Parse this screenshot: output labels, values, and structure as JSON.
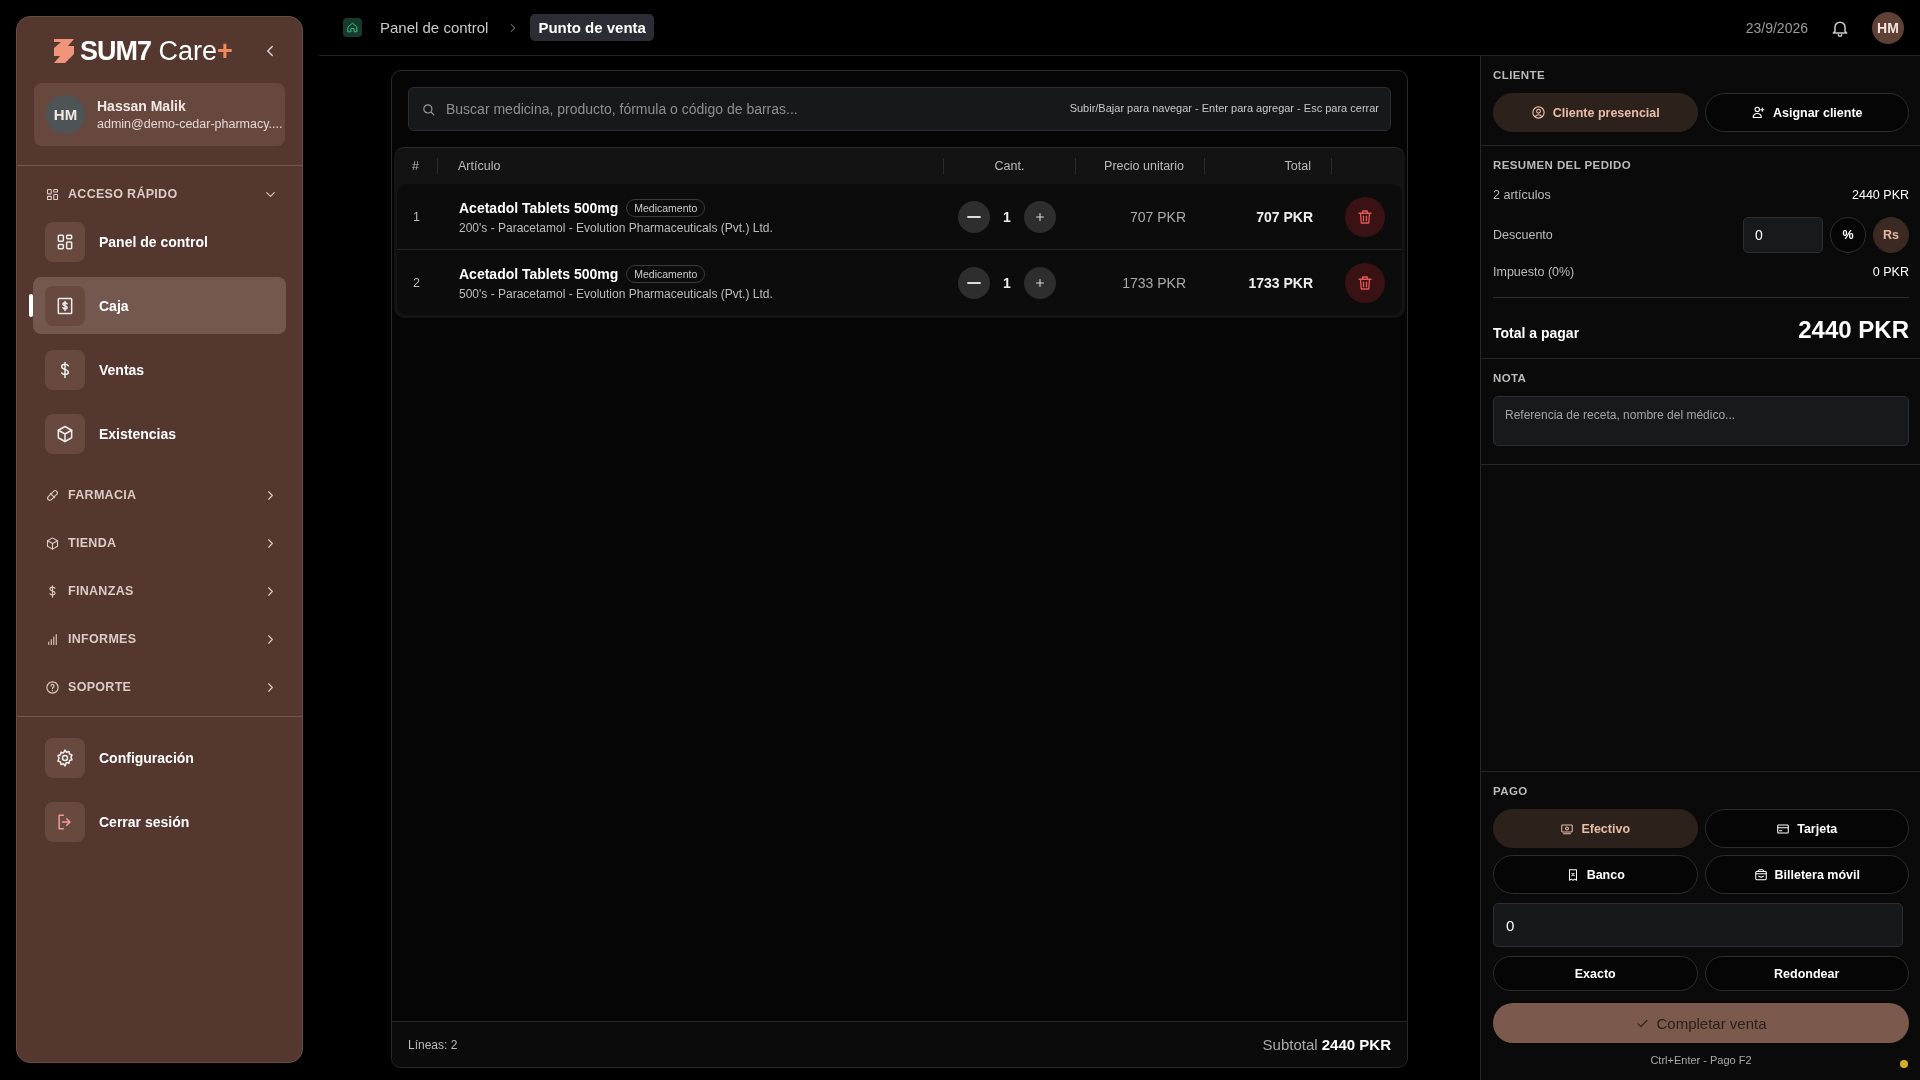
{
  "sidebar": {
    "logo": {
      "brand": "SUM7",
      "product": "Care",
      "accent": "+"
    },
    "user": {
      "initials": "HM",
      "name": "Hassan Malik",
      "email": "admin@demo-cedar-pharmacy...."
    },
    "quick_access": {
      "label": "ACCESO RÁPIDO",
      "expanded": true,
      "items": [
        {
          "label": "Panel de control",
          "selected": false
        },
        {
          "label": "Caja",
          "selected": true
        },
        {
          "label": "Ventas",
          "selected": false
        },
        {
          "label": "Existencias",
          "selected": false
        }
      ]
    },
    "groups": [
      {
        "label": "FARMACIA"
      },
      {
        "label": "TIENDA"
      },
      {
        "label": "FINANZAS"
      },
      {
        "label": "INFORMES"
      },
      {
        "label": "SOPORTE"
      }
    ],
    "footer_items": [
      {
        "label": "Configuración"
      },
      {
        "label": "Cerrar sesión"
      }
    ]
  },
  "topbar": {
    "breadcrumbs": [
      {
        "label": "Panel de control",
        "selected": false
      },
      {
        "label": "Punto de venta",
        "selected": true
      }
    ],
    "date": "23/9/2026",
    "avatar": "HM"
  },
  "cart": {
    "search": {
      "placeholder": "Buscar medicina, producto, fórmula o código de barras...",
      "hint": "Subir/Bajar para navegar - Enter para agregar - Esc para cerrar"
    },
    "columns": [
      "#",
      "Artículo",
      "Cant.",
      "Precio unitario",
      "Total"
    ],
    "rows": [
      {
        "index": "1",
        "name": "Acetadol Tablets 500mg",
        "tag": "Medicamento",
        "detail": "200's - Paracetamol - Evolution Pharmaceuticals (Pvt.) Ltd.",
        "qty": "1",
        "unit_price": "707 PKR",
        "total": "707 PKR"
      },
      {
        "index": "2",
        "name": "Acetadol Tablets 500mg",
        "tag": "Medicamento",
        "detail": "500's - Paracetamol - Evolution Pharmaceuticals (Pvt.) Ltd.",
        "qty": "1",
        "unit_price": "1733 PKR",
        "total": "1733 PKR"
      }
    ],
    "lines": "Líneas: 2",
    "subtotal_label": "Subtotal",
    "subtotal": "2440 PKR"
  },
  "panel": {
    "client": {
      "title": "CLIENTE",
      "options": [
        {
          "label": "Cliente presencial",
          "selected": true
        },
        {
          "label": "Asignar cliente",
          "selected": false
        }
      ]
    },
    "summary": {
      "title": "RESUMEN DEL PEDIDO",
      "items_label": "2 artículos",
      "items_value": "2440 PKR",
      "discount_label": "Descuento",
      "discount_value": "0",
      "discount_modes": [
        {
          "label": "%",
          "selected": false
        },
        {
          "label": "Rs",
          "selected": true
        }
      ],
      "tax_label": "Impuesto (0%)",
      "tax_value": "0 PKR",
      "total_label": "Total a pagar",
      "total_value": "2440 PKR"
    },
    "note": {
      "title": "NOTA",
      "placeholder": "Referencia de receta, nombre del médico..."
    },
    "payment": {
      "title": "PAGO",
      "methods": [
        {
          "label": "Efectivo",
          "selected": true
        },
        {
          "label": "Tarjeta",
          "selected": false
        },
        {
          "label": "Banco",
          "selected": false
        },
        {
          "label": "Billetera móvil",
          "selected": false
        }
      ],
      "amount": "0",
      "quick_buttons": [
        "Exacto",
        "Redondear"
      ],
      "complete": "Completar venta",
      "shortcut": "Ctrl+Enter - Pago F2"
    }
  }
}
